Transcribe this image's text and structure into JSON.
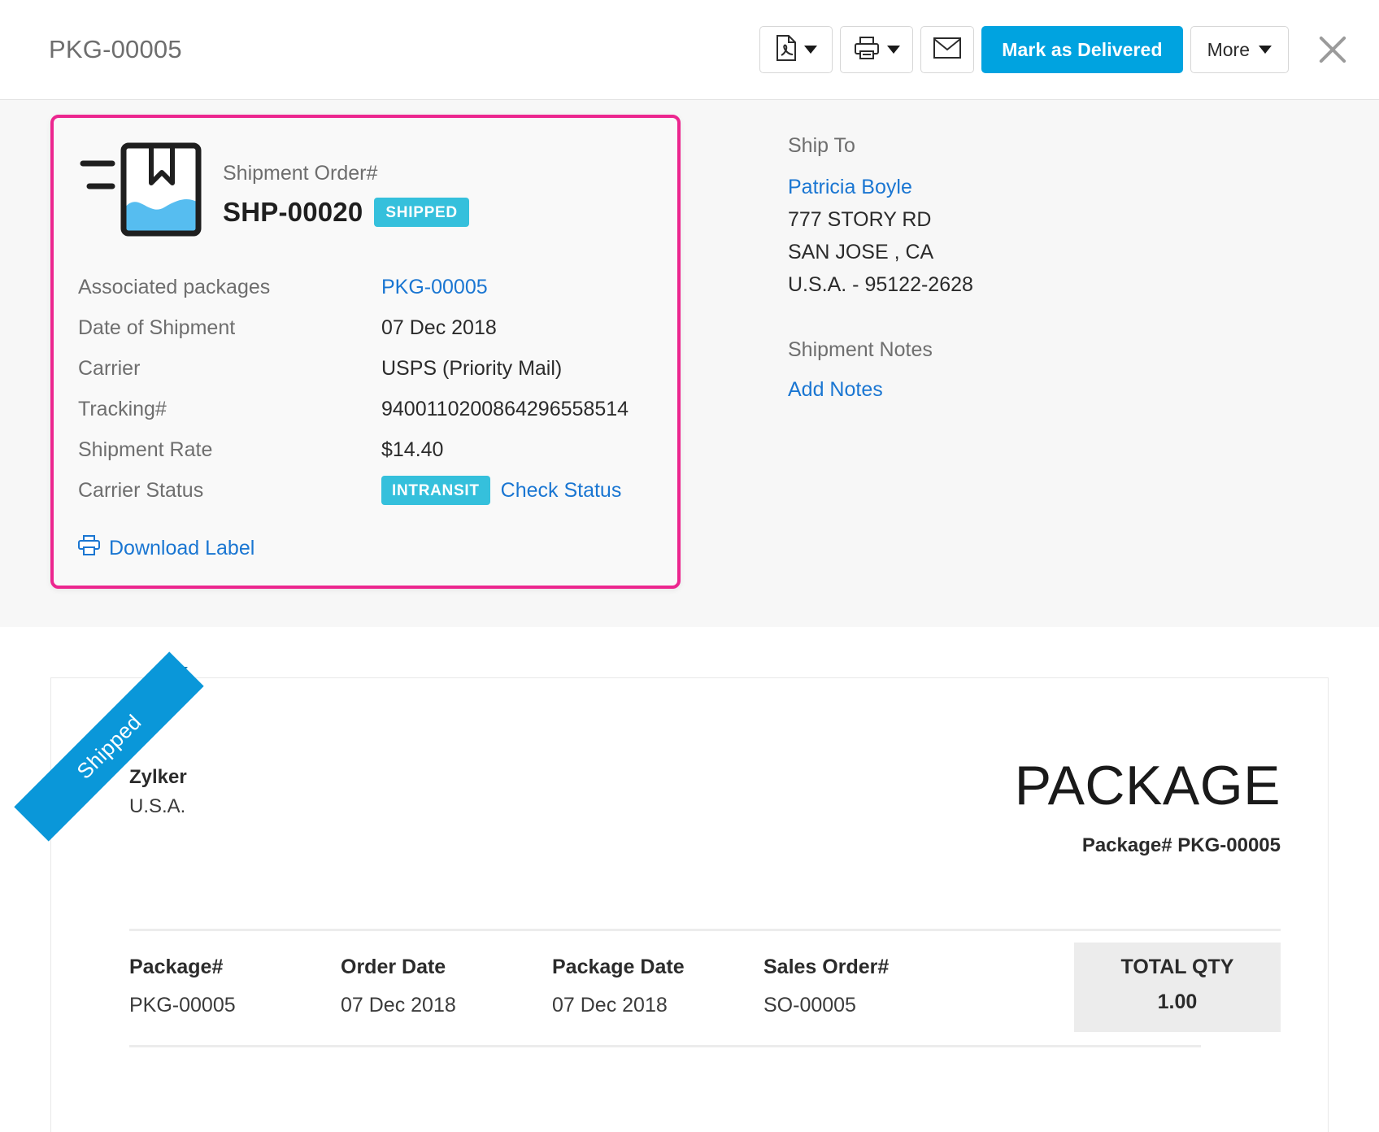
{
  "header": {
    "title": "PKG-00005",
    "pdf_button": "pdf-export",
    "print_button": "print",
    "email_button": "email",
    "primary_action": "Mark as Delivered",
    "more_label": "More",
    "close_label": "Close"
  },
  "shipment_card": {
    "order_label": "Shipment Order#",
    "order_number": "SHP-00020",
    "status_badge": "SHIPPED",
    "rows": [
      {
        "label": "Associated packages",
        "value": "PKG-00005",
        "kind": "link"
      },
      {
        "label": "Date of Shipment",
        "value": "07 Dec 2018",
        "kind": "text"
      },
      {
        "label": "Carrier",
        "value": "USPS (Priority Mail)",
        "kind": "text"
      },
      {
        "label": "Tracking#",
        "value": "9400110200864296558514",
        "kind": "text"
      },
      {
        "label": "Shipment Rate",
        "value": "$14.40",
        "kind": "text"
      },
      {
        "label": "Carrier Status",
        "value": "INTRANSIT",
        "kind": "badge"
      }
    ],
    "carrier_status_badge": "INTRANSIT",
    "check_status_link": "Check Status",
    "download_label": "Download Label",
    "highlight_color": "#ec268f",
    "badge_color": "#35c0dc"
  },
  "ship_to": {
    "label": "Ship To",
    "name": "Patricia Boyle",
    "address_line1": "777 STORY RD",
    "address_line2": "SAN JOSE , CA",
    "address_line3": "U.S.A. - 95122-2628",
    "notes_label": "Shipment Notes",
    "add_notes_link": "Add Notes"
  },
  "document": {
    "ribbon_text": "Shipped",
    "ribbon_color": "#0a97d9",
    "company_name": "Zylker",
    "company_country": "U.S.A.",
    "title": "PACKAGE",
    "subtitle": "Package# PKG-00005",
    "table": {
      "columns": [
        {
          "header": "Package#",
          "value": "PKG-00005"
        },
        {
          "header": "Order Date",
          "value": "07 Dec 2018"
        },
        {
          "header": "Package Date",
          "value": "07 Dec 2018"
        },
        {
          "header": "Sales Order#",
          "value": "SO-00005"
        }
      ],
      "qty_column": {
        "header": "TOTAL QTY",
        "value": "1.00"
      }
    }
  }
}
